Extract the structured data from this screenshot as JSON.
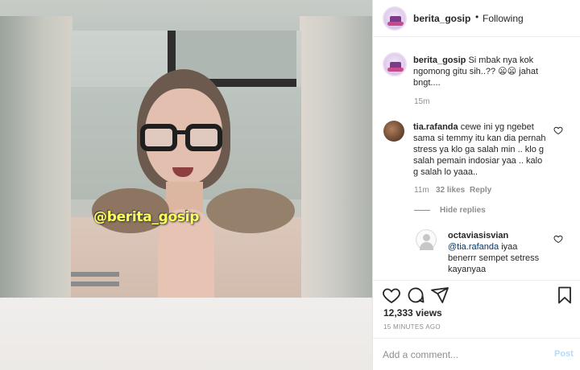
{
  "media": {
    "watermark": "@berita_gosip"
  },
  "header": {
    "username": "berita_gosip",
    "separator": "•",
    "follow_status": "Following"
  },
  "caption": {
    "username": "berita_gosip",
    "text_line1": "Si mbak nya kok",
    "text_line2": "ngomong gitu sih..?? 😦😦 jahat",
    "text_line3": "bngt....",
    "time": "15m"
  },
  "comments": [
    {
      "username": "tia.rafanda",
      "lines": [
        "cewe ini yg ngebet",
        "sama si temmy itu kan dia pernah",
        "stress ya klo ga salah min .. klo g",
        "salah pemain indosiar yaa .. kalo",
        "g salah lo yaaa.."
      ],
      "time": "11m",
      "likes": "32 likes",
      "reply_label": "Reply",
      "hide_replies": "Hide replies",
      "replies": [
        {
          "username": "octaviasisvian",
          "mention": "@tia.rafanda",
          "lines": [
            "iyaa",
            "benerrr sempet setress",
            "kayanyaa"
          ]
        }
      ]
    }
  ],
  "actions": {
    "views": "12,333 views",
    "time_ago": "15 MINUTES AGO"
  },
  "add_comment": {
    "placeholder": "Add a comment...",
    "post_label": "Post"
  },
  "colors": {
    "link": "#00376b",
    "post_disabled": "#b3dbff",
    "watermark": "#ffff5c"
  }
}
